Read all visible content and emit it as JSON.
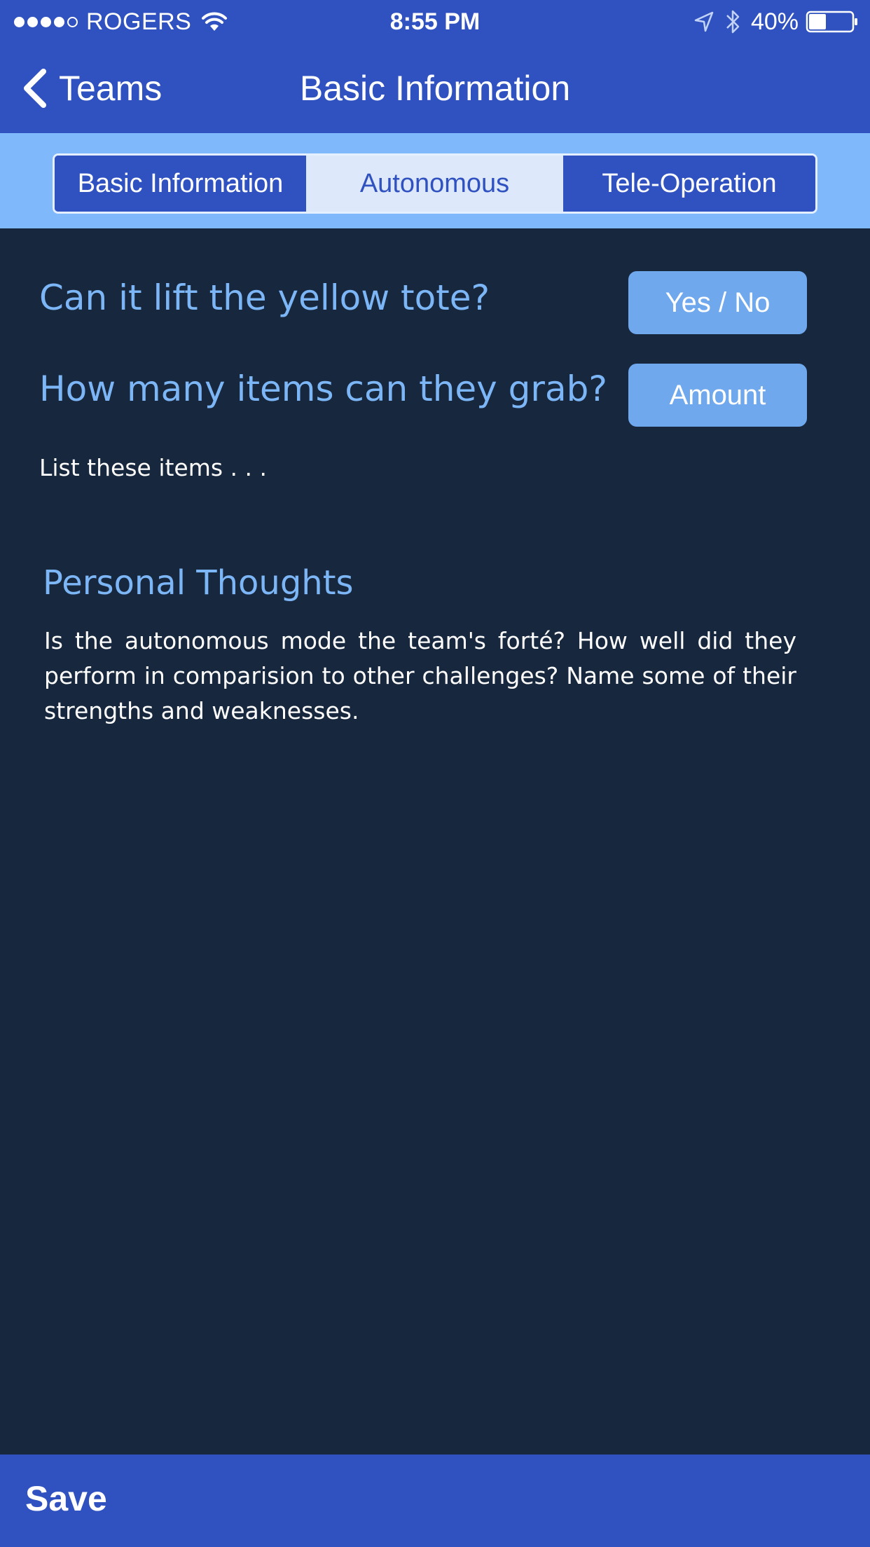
{
  "status_bar": {
    "carrier": "ROGERS",
    "time": "8:55 PM",
    "battery_percent": "40%",
    "battery_level": 0.4,
    "signal_bars_filled": 4,
    "signal_bars_total": 5,
    "icons": [
      "signal-dots-icon",
      "wifi-icon",
      "location-icon",
      "bluetooth-icon",
      "battery-icon"
    ]
  },
  "nav": {
    "back_label": "Teams",
    "title": "Basic Information"
  },
  "segments": {
    "items": [
      "Basic Information",
      "Autonomous",
      "Tele-Operation"
    ],
    "selected": "Autonomous"
  },
  "questions": {
    "lift": {
      "label": "Can it lift the yellow tote?",
      "button": "Yes / No"
    },
    "grab": {
      "label": "How many items can they grab?",
      "button": "Amount"
    },
    "list_placeholder": "List these items . . ."
  },
  "personal": {
    "title": "Personal Thoughts",
    "body": "Is the autonomous mode the team's forté? How well did they perform in comparision to other challenges? Name some of their strengths and weaknesses."
  },
  "footer": {
    "save_label": "Save"
  },
  "colors": {
    "bar_blue": "#3052c0",
    "segment_bar": "#7fb8fb",
    "background": "#17273d",
    "accent_text": "#7db6f6",
    "answer_button": "#6fa8ed",
    "selected_segment": "#dde8fb"
  }
}
